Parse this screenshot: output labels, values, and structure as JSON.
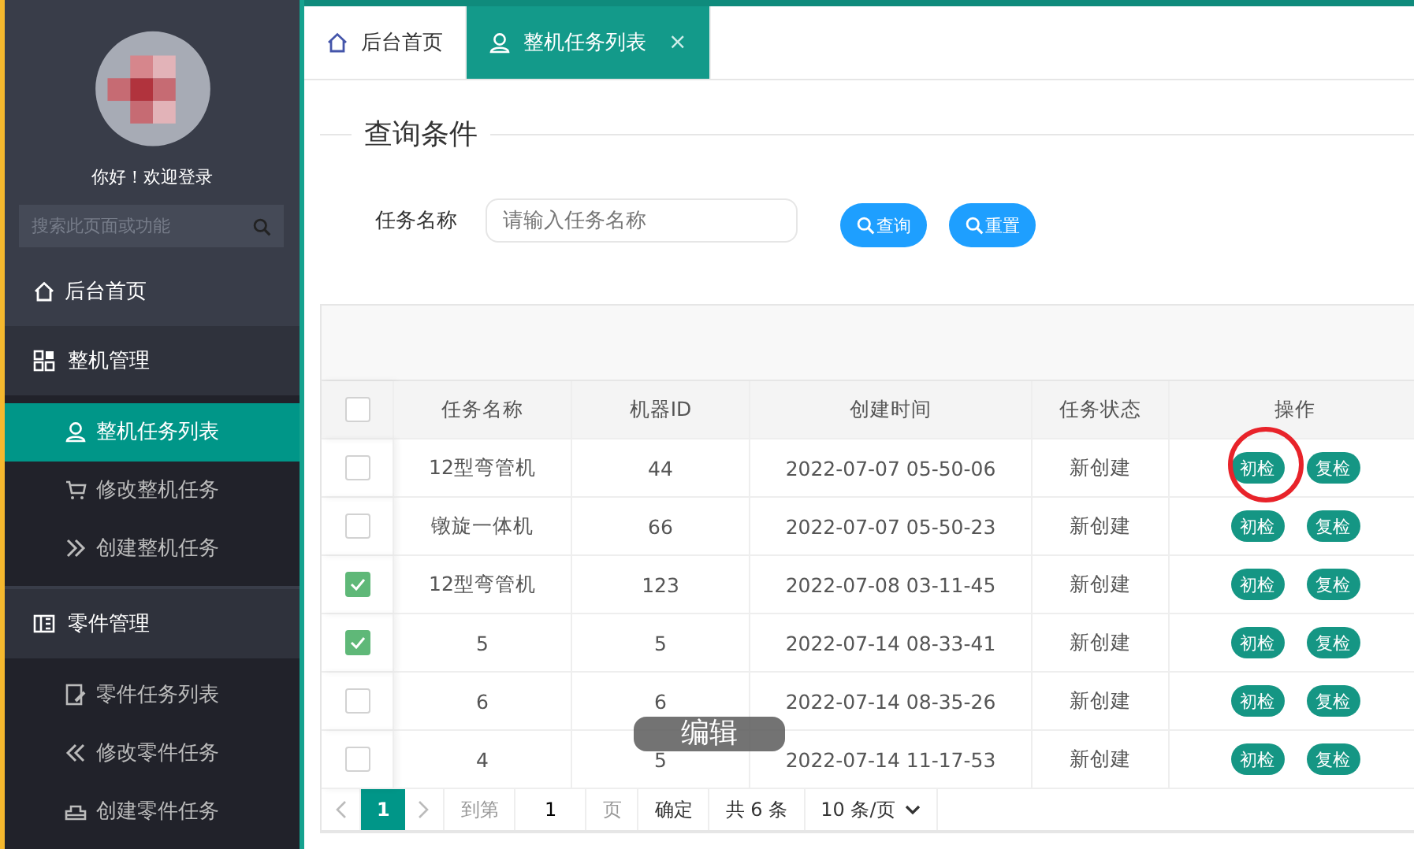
{
  "sidebar": {
    "greeting": "你好！欢迎登录",
    "search": {
      "placeholder": "搜索此页面或功能"
    },
    "items": [
      {
        "label": "后台首页",
        "kind": "home"
      },
      {
        "label": "整机管理",
        "kind": "grid",
        "expanded": true,
        "children": [
          {
            "label": "整机任务列表",
            "kind": "user",
            "selected": true
          },
          {
            "label": "修改整机任务",
            "kind": "cart",
            "selected": false
          },
          {
            "label": "创建整机任务",
            "kind": "forward",
            "selected": false
          }
        ]
      },
      {
        "label": "零件管理",
        "kind": "book",
        "expanded": true,
        "children": [
          {
            "label": "零件任务列表",
            "kind": "document",
            "selected": false
          },
          {
            "label": "修改零件任务",
            "kind": "back",
            "selected": false
          },
          {
            "label": "创建零件任务",
            "kind": "tray",
            "selected": false
          }
        ]
      }
    ]
  },
  "tabs": [
    {
      "label": "后台首页",
      "kind": "home",
      "selected": false
    },
    {
      "label": "整机任务列表",
      "kind": "user",
      "selected": true,
      "close": "×"
    }
  ],
  "query": {
    "legend": "查询条件",
    "field_label": "任务名称",
    "placeholder": "请输入任务名称",
    "buttons": [
      "查询",
      "重置"
    ]
  },
  "table": {
    "header_checked": false,
    "columns": [
      "任务名称",
      "机器ID",
      "创建时间",
      "任务状态",
      "操作"
    ],
    "rows": [
      {
        "checked": false,
        "cells": [
          "12型弯管机",
          "44",
          "2022-07-07 05-50-06",
          "新创建"
        ],
        "actions": [
          {
            "label": "初检",
            "circled": true
          },
          {
            "label": "复检",
            "circled": false
          }
        ]
      },
      {
        "checked": false,
        "cells": [
          "镦旋一体机",
          "66",
          "2022-07-07 05-50-23",
          "新创建"
        ],
        "actions": [
          {
            "label": "初检",
            "circled": false
          },
          {
            "label": "复检",
            "circled": false
          }
        ]
      },
      {
        "checked": true,
        "cells": [
          "12型弯管机",
          "123",
          "2022-07-08 03-11-45",
          "新创建"
        ],
        "actions": [
          {
            "label": "初检",
            "circled": false
          },
          {
            "label": "复检",
            "circled": false
          }
        ]
      },
      {
        "checked": true,
        "cells": [
          "5",
          "5",
          "2022-07-14 08-33-41",
          "新创建"
        ],
        "actions": [
          {
            "label": "初检",
            "circled": false
          },
          {
            "label": "复检",
            "circled": false
          }
        ]
      },
      {
        "checked": false,
        "cells": [
          "6",
          "6",
          "2022-07-14 08-35-26",
          "新创建"
        ],
        "actions": [
          {
            "label": "初检",
            "circled": false
          },
          {
            "label": "复检",
            "circled": false
          }
        ]
      },
      {
        "checked": false,
        "cells": [
          "4",
          "5",
          "2022-07-14 11-17-53",
          "新创建"
        ],
        "actions": [
          {
            "label": "初检",
            "circled": false
          },
          {
            "label": "复检",
            "circled": false
          }
        ]
      }
    ]
  },
  "pagination": {
    "pages": [
      {
        "label": "1",
        "selected": true
      }
    ],
    "goto_label": "到第",
    "goto_value": "1",
    "page_unit": "页",
    "confirm": "确定",
    "total": "共 6 条",
    "page_size": "10 条/页"
  },
  "tooltip": {
    "text": "编辑"
  }
}
